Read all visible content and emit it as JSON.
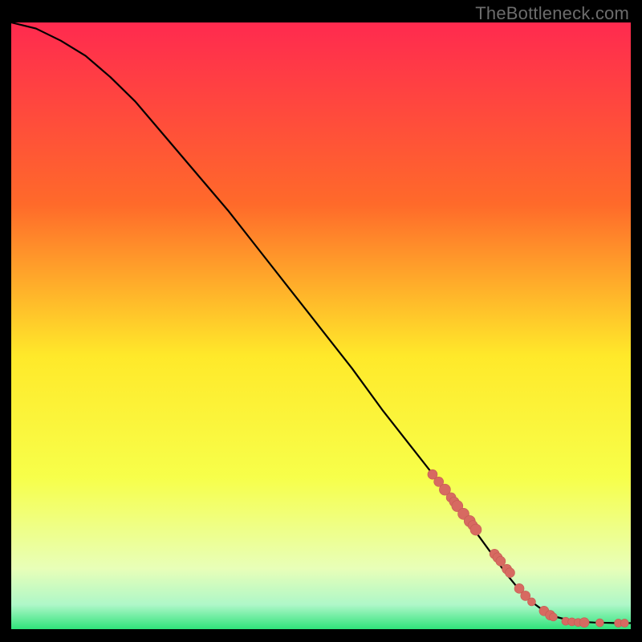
{
  "watermark": "TheBottleneck.com",
  "colors": {
    "bg_black": "#000000",
    "curve": "#000000",
    "marker_fill": "#d76a61",
    "marker_stroke": "#c45a52",
    "grad_top": "#ff2a4f",
    "grad_mid_upper": "#ff8a2a",
    "grad_mid": "#ffe92a",
    "grad_mid_lower": "#f0ff60",
    "grad_near_bottom": "#c8ffb0",
    "grad_bottom": "#2fe37a"
  },
  "chart_data": {
    "type": "line",
    "title": "",
    "xlabel": "",
    "ylabel": "",
    "xlim": [
      0,
      100
    ],
    "ylim": [
      0,
      100
    ],
    "curve": {
      "x": [
        0,
        4,
        8,
        12,
        16,
        20,
        25,
        30,
        35,
        40,
        45,
        50,
        55,
        60,
        65,
        70,
        75,
        80,
        82,
        84,
        86,
        88,
        90,
        92,
        94,
        96,
        98,
        100
      ],
      "y": [
        100,
        99,
        97,
        94.5,
        91,
        87,
        81,
        75,
        69,
        62.5,
        56,
        49.5,
        43,
        36,
        29.5,
        23,
        16,
        9,
        6.5,
        4.5,
        3,
        2,
        1.5,
        1.2,
        1.1,
        1.05,
        1.0,
        1.0
      ]
    },
    "markers": {
      "x": [
        68,
        69,
        70,
        71,
        71.5,
        72,
        73,
        74,
        74.5,
        75,
        78,
        78.5,
        79,
        80,
        80.5,
        82,
        83,
        84,
        86,
        87,
        87.5,
        89.5,
        90.5,
        91.5,
        92.5,
        95,
        98,
        99
      ],
      "y": [
        25.5,
        24.3,
        23.0,
        21.7,
        21.0,
        20.3,
        19.0,
        17.8,
        17.1,
        16.4,
        12.4,
        11.8,
        11.2,
        9.9,
        9.3,
        6.7,
        5.5,
        4.5,
        3.0,
        2.3,
        2.0,
        1.3,
        1.2,
        1.1,
        1.1,
        1.05,
        1.0,
        1.0
      ],
      "radii": [
        6,
        6,
        7,
        6,
        6,
        7,
        7,
        7,
        6,
        7,
        6,
        6,
        6,
        6,
        6,
        6,
        6,
        5,
        6,
        6,
        5,
        5,
        5,
        5,
        6,
        5,
        5,
        5
      ]
    }
  }
}
